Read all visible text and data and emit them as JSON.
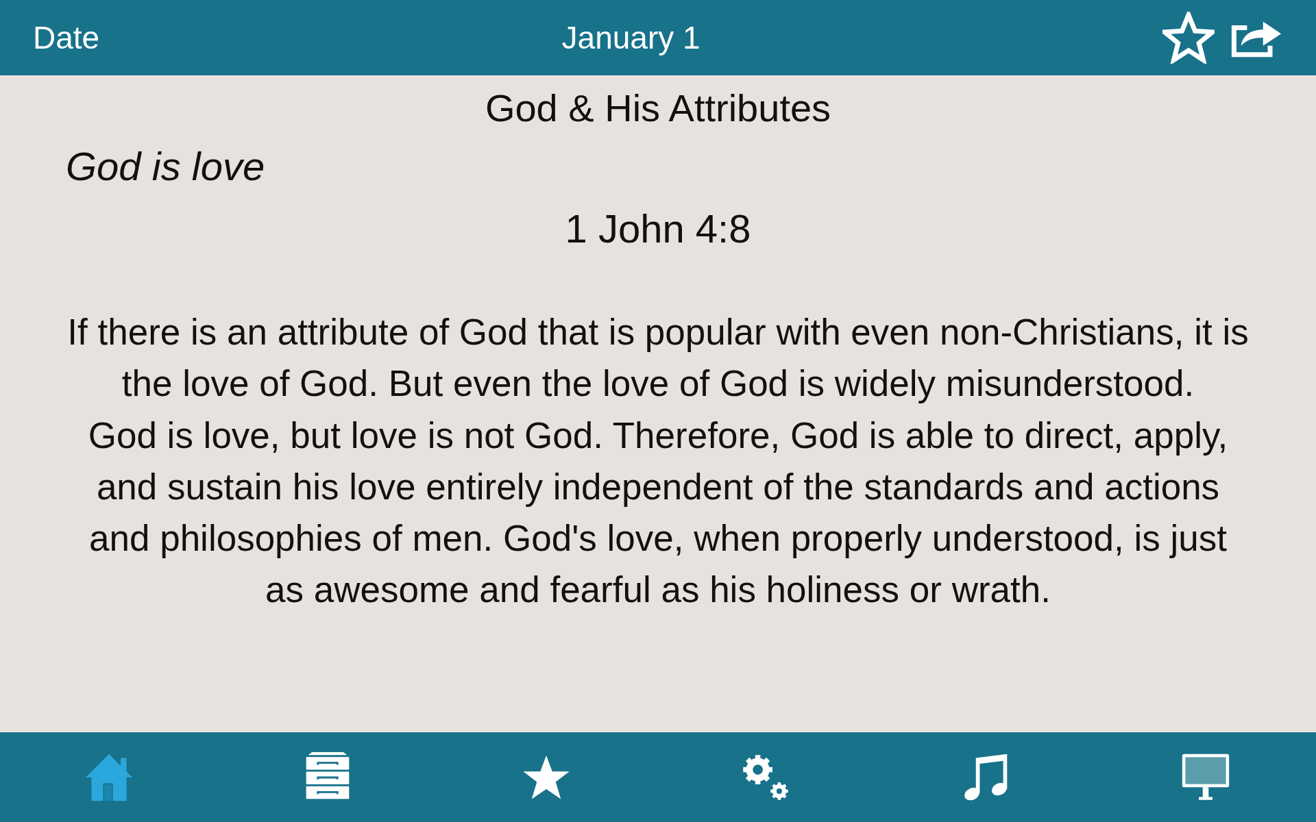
{
  "nav_bar": {
    "back_label": "Date",
    "title": "January 1"
  },
  "reading": {
    "heading": "God & His Attributes",
    "theme": "God is love",
    "reference": "1 John 4:8",
    "paragraphs": [
      "If there is an attribute of God that is popular with even non-Christians, it is the love of God. But even the love of God is widely misunderstood.",
      "God is love, but love is not God. Therefore, God is able to direct, apply, and sustain his love entirely independent of the standards and actions and philosophies of men. God's love, when properly understood, is just as awesome and fearful as his holiness or wrath."
    ]
  },
  "tab_bar": [
    {
      "kind": "home",
      "selected": true
    },
    {
      "kind": "cabinet",
      "selected": false
    },
    {
      "kind": "star",
      "selected": false
    },
    {
      "kind": "gears",
      "selected": false
    },
    {
      "kind": "music",
      "selected": false
    },
    {
      "kind": "monitor",
      "selected": false
    }
  ]
}
